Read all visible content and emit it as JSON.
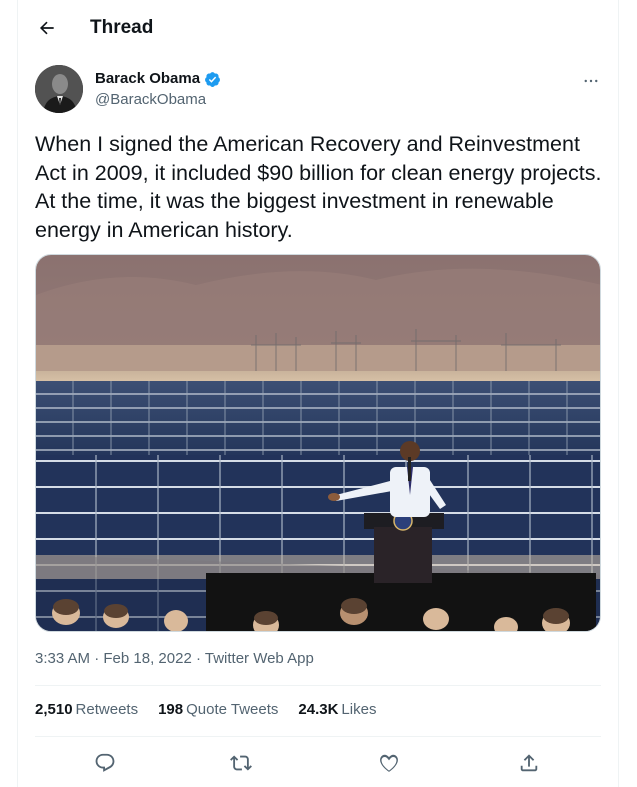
{
  "header": {
    "title": "Thread",
    "back_icon": "arrow-left-icon"
  },
  "tweet": {
    "author": {
      "name": "Barack Obama",
      "handle": "@BarackObama",
      "verified": true,
      "verified_color": "#1d9bf0"
    },
    "text": "When I signed the American Recovery and Reinvestment Act in 2009, it included $90 billion for clean energy projects. At the time, it was the biggest investment in renewable energy in American history.",
    "time": "3:33 AM",
    "date": "Feb 18, 2022",
    "source": "Twitter Web App",
    "separator": " · ",
    "stats": {
      "retweets_count": "2,510",
      "retweets_label": "Retweets",
      "quote_count": "198",
      "quote_label": "Quote Tweets",
      "likes_count": "24.3K",
      "likes_label": "Likes"
    }
  },
  "actions": [
    "reply-icon",
    "retweet-icon",
    "like-icon",
    "share-icon"
  ],
  "colors": {
    "text": "#0f1419",
    "secondary": "#536471",
    "accent": "#1d9bf0",
    "border": "#eff3f4"
  }
}
